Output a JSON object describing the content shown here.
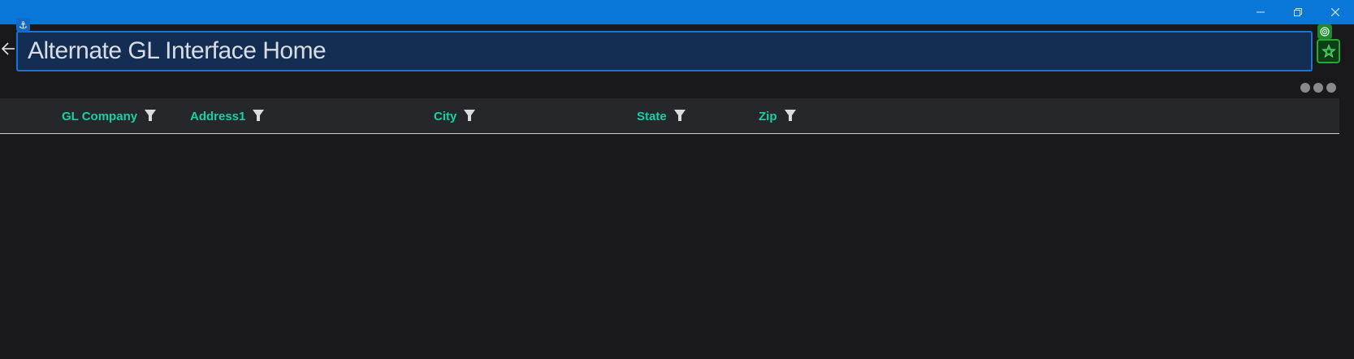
{
  "window": {
    "title_bar_color": "#0a78d8",
    "controls": [
      {
        "name": "minimize",
        "icon": "minimize-icon"
      },
      {
        "name": "restore",
        "icon": "restore-icon"
      },
      {
        "name": "close",
        "icon": "close-icon"
      }
    ]
  },
  "header": {
    "title": "Alternate GL Interface Home",
    "back_icon": "arrow-left-icon",
    "anchor_icon": "anchor-icon",
    "anchor_glyph": "⚓"
  },
  "toolbar": {
    "target_icon": "target-icon",
    "star_icon": "star-icon",
    "more_icon": "more-dots-icon"
  },
  "grid": {
    "columns": [
      {
        "label": "GL Company"
      },
      {
        "label": "Address1"
      },
      {
        "label": "City"
      },
      {
        "label": "State"
      },
      {
        "label": "Zip"
      }
    ],
    "rows": []
  },
  "colors": {
    "accent": "#16d1a6",
    "background": "#19191c",
    "header_bg": "#26272b",
    "title_box_bg": "#142d52",
    "title_box_border": "#1a73d6",
    "green": "#24a83a"
  }
}
